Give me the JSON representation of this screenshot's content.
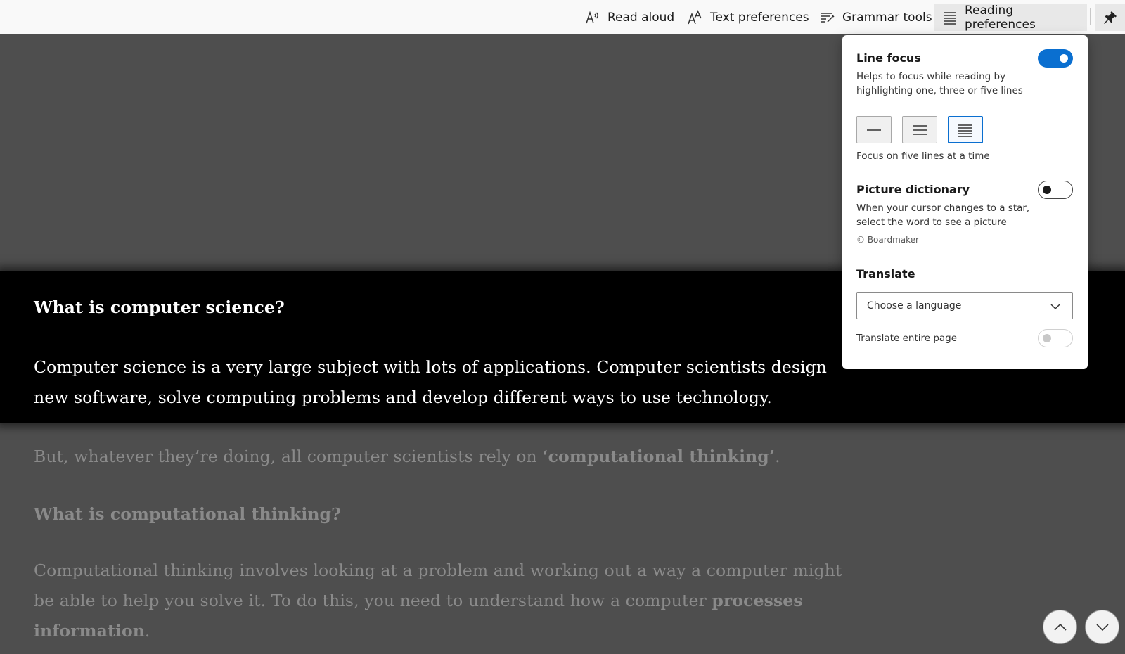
{
  "toolbar": {
    "read_aloud": "Read aloud",
    "text_preferences": "Text preferences",
    "grammar_tools": "Grammar tools",
    "reading_preferences": "Reading preferences",
    "active_tab": "Reading preferences",
    "icons": [
      "read-aloud-icon",
      "text-preferences-icon",
      "grammar-tools-icon",
      "reading-preferences-icon",
      "pin-icon"
    ]
  },
  "content": {
    "heading1": "What is computer science?",
    "para1_line1": "Computer science is a very large subject with lots of applications. Computer scientists design",
    "para1_line2": "new software, solve computing problems and develop different ways to use technology.",
    "para2_pre": "But, whatever they’re doing, all computer scientists rely on ",
    "para2_bold": "‘computational thinking’",
    "para2_post": ".",
    "heading2": "What is computational thinking?",
    "para3_line1": "Computational thinking involves looking at a problem and working out a way a computer might",
    "para3_line2_pre": "be able to help you solve it. To do this, you need to understand how a computer ",
    "para3_line2_bold": "processes",
    "para3_line3_bold": "information",
    "para3_line3_post": "."
  },
  "panel": {
    "line_focus": {
      "title": "Line focus",
      "description": "Helps to focus while reading by highlighting one, three or five lines",
      "enabled": true,
      "options": [
        "one-line",
        "three-lines",
        "five-lines"
      ],
      "selected": "five-lines",
      "status": "Focus on five lines at a time"
    },
    "picture_dictionary": {
      "title": "Picture dictionary",
      "description": "When your cursor changes to a star, select the word to see a picture",
      "enabled": false,
      "credit": "© Boardmaker"
    },
    "translate": {
      "title": "Translate",
      "language_placeholder": "Choose a language",
      "entire_page_label": "Translate entire page",
      "entire_page_enabled": false
    }
  },
  "colors": {
    "accent": "#0a6fd0",
    "focus_band": "#000000",
    "dim_overlay": "#4e4e4e"
  }
}
